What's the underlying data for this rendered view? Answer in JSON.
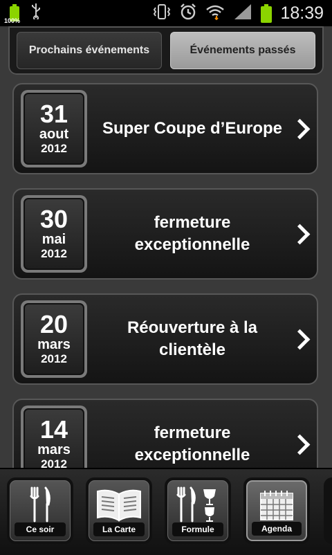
{
  "status_bar": {
    "battery_small_percent": "100%",
    "time": "18:39",
    "icons": [
      "battery-icon",
      "usb-icon",
      "vibrate-icon",
      "alarm-icon",
      "wifi-icon",
      "signal-icon",
      "battery-icon"
    ]
  },
  "tabs": {
    "upcoming_label": "Prochains événements",
    "past_label": "Événements passés",
    "active": "past"
  },
  "events": [
    {
      "day": "31",
      "month": "aout",
      "year": "2012",
      "title": "Super Coupe d’Europe"
    },
    {
      "day": "30",
      "month": "mai",
      "year": "2012",
      "title": "fermeture exceptionnelle"
    },
    {
      "day": "20",
      "month": "mars",
      "year": "2012",
      "title": "Réouverture à la clientèle"
    },
    {
      "day": "14",
      "month": "mars",
      "year": "2012",
      "title": "fermeture exceptionnelle"
    }
  ],
  "nav": {
    "items": [
      {
        "label": "Ce soir",
        "icon": "cutlery-icon"
      },
      {
        "label": "La Carte",
        "icon": "menu-book-icon"
      },
      {
        "label": "Formule",
        "icon": "cutlery-glasses-icon"
      },
      {
        "label": "Agenda",
        "icon": "calendar-icon"
      }
    ],
    "active_index": 3
  },
  "colors": {
    "battery": "#8bd400",
    "background": "#3a3a3a",
    "card": "#1c1c1c"
  }
}
